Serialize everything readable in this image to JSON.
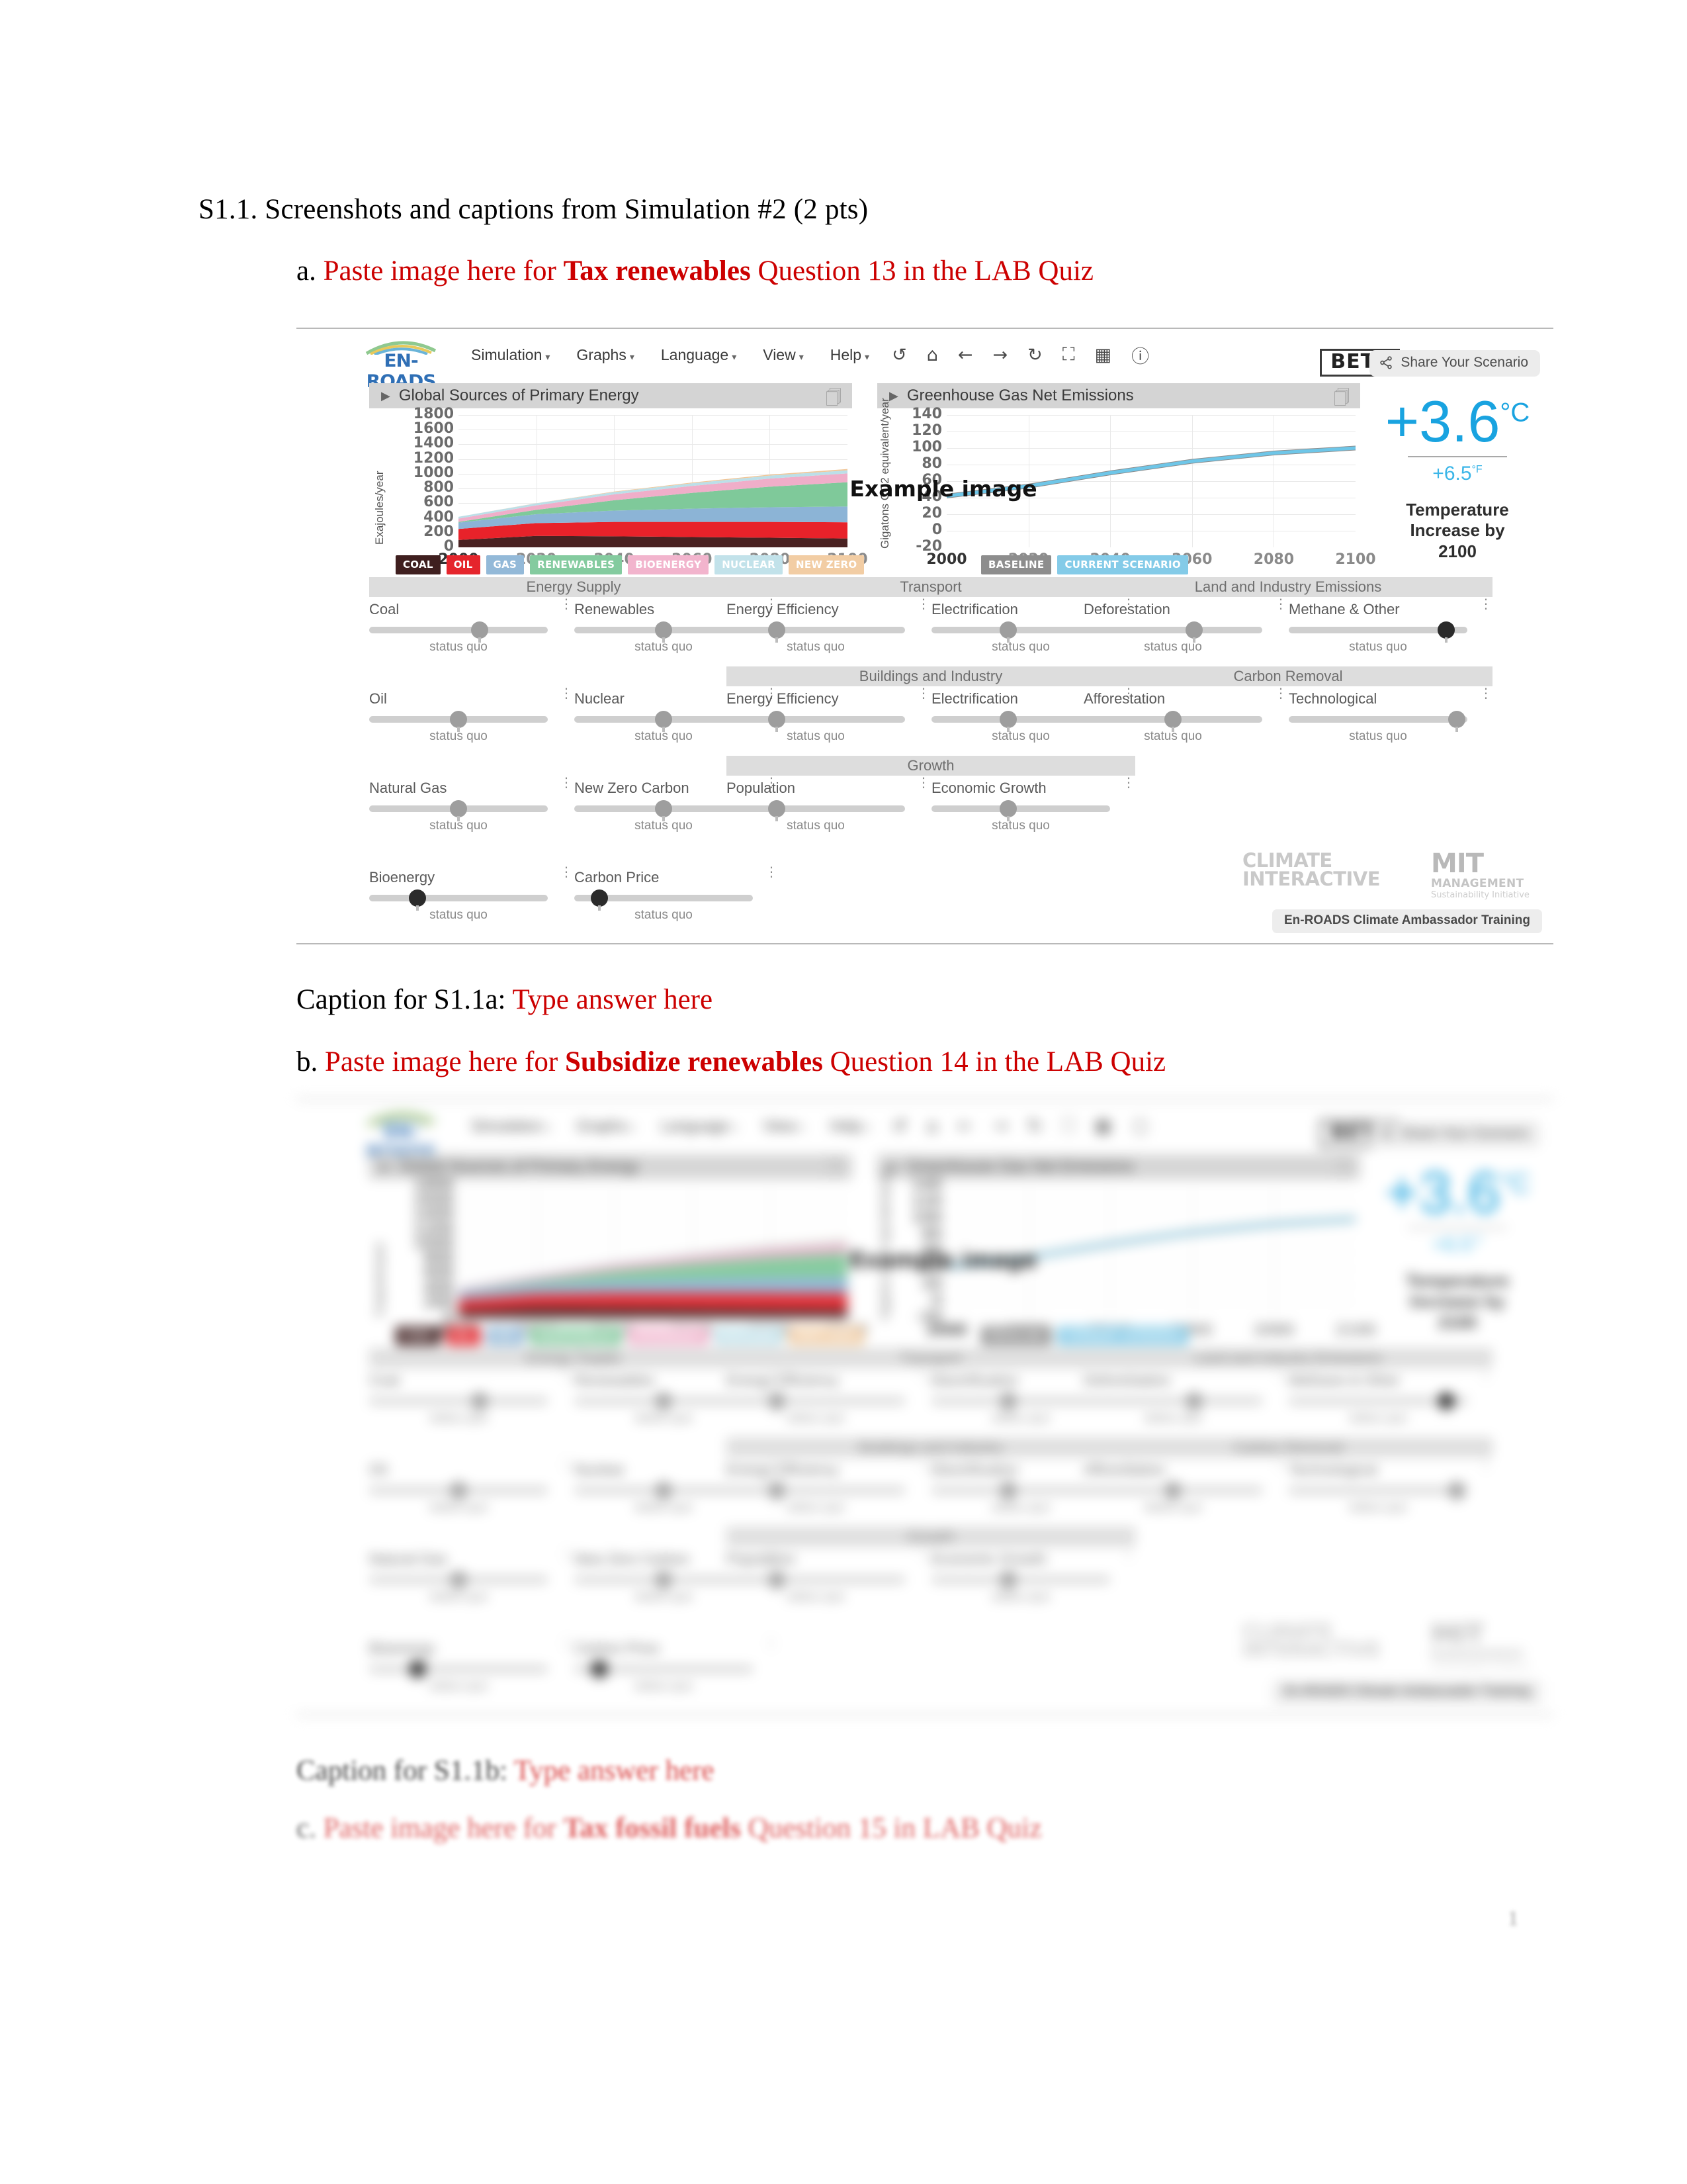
{
  "document": {
    "heading": "S1.1. Screenshots and captions from Simulation #2 (2 pts)",
    "page_number": "1",
    "items": [
      {
        "marker": "a.",
        "prefix": "Paste image here for ",
        "bold": "Tax renewables",
        "suffix": " Question 13 in the LAB Quiz"
      },
      {
        "marker": "b.",
        "prefix": "Paste image here for ",
        "bold": "Subsidize renewables",
        "suffix": " Question 14 in the LAB Quiz"
      },
      {
        "marker": "c.",
        "prefix": "Paste image here for ",
        "bold": "Tax fossil fuels",
        "suffix": " Question 15 in LAB Quiz"
      }
    ],
    "captions": [
      {
        "label": "Caption for S1.1a:",
        "answer": " Type answer here"
      },
      {
        "label": "Caption for S1.1b:",
        "answer": " Type answer here"
      }
    ]
  },
  "enroads": {
    "brand": "EN-ROADS",
    "menu": [
      {
        "label": "Simulation",
        "caret": "▾"
      },
      {
        "label": "Graphs",
        "caret": "▾"
      },
      {
        "label": "Language",
        "caret": "▾"
      },
      {
        "label": "View",
        "caret": "▾"
      },
      {
        "label": "Help",
        "caret": "▾"
      }
    ],
    "tool_icons": [
      {
        "name": "undo-icon",
        "glyph": "↺"
      },
      {
        "name": "home-icon",
        "glyph": "⌂"
      },
      {
        "name": "back-arrow-icon",
        "glyph": "←"
      },
      {
        "name": "forward-arrow-icon",
        "glyph": "→"
      },
      {
        "name": "redo-icon",
        "glyph": "↻"
      },
      {
        "name": "fullscreen-icon",
        "glyph": "⛶"
      },
      {
        "name": "grid-icon",
        "glyph": "▦"
      },
      {
        "name": "info-icon",
        "glyph": "ⓘ"
      }
    ],
    "beta_badge": "BETA",
    "share_button": "Share Your Scenario",
    "watermark": "Example image",
    "temperature": {
      "celsius": "+3.6",
      "celsius_unit": "°C",
      "fahrenheit": "+6.5",
      "fahrenheit_unit": "°F",
      "caption_line1": "Temperature",
      "caption_line2": "Increase by",
      "caption_line3": "2100"
    },
    "footer": {
      "climate_interactive_line1": "CLIMATE",
      "climate_interactive_line2": "INTERACTIVE",
      "mit": "MIT",
      "mit_management": "MANAGEMENT",
      "mit_sub": "Sustainability Initiative",
      "ambassador_button": "En-ROADS Climate Ambassador Training"
    },
    "slider_groups": [
      {
        "header": "Energy Supply",
        "rows": [
          [
            {
              "label": "Coal",
              "value": "status quo",
              "knob": 0.62,
              "dark": false
            },
            {
              "label": "Renewables",
              "value": "status quo",
              "knob": 0.5,
              "dark": false
            }
          ],
          [
            {
              "label": "Oil",
              "value": "status quo",
              "knob": 0.5,
              "dark": false
            },
            {
              "label": "Nuclear",
              "value": "status quo",
              "knob": 0.5,
              "dark": false
            }
          ],
          [
            {
              "label": "Natural Gas",
              "value": "status quo",
              "knob": 0.5,
              "dark": false
            },
            {
              "label": "New Zero Carbon",
              "value": "status quo",
              "knob": 0.5,
              "dark": false
            }
          ],
          [
            {
              "label": "Bioenergy",
              "value": "status quo",
              "knob": 0.27,
              "dark": true
            },
            {
              "label": "Carbon Price",
              "value": "status quo",
              "knob": 0.14,
              "dark": true
            }
          ]
        ]
      },
      {
        "header": "Transport",
        "rows": [
          [
            {
              "label": "Energy Efficiency",
              "value": "status quo",
              "knob": 0.28,
              "dark": false
            },
            {
              "label": "Electrification",
              "value": "status quo",
              "knob": 0.43,
              "dark": false
            }
          ]
        ]
      },
      {
        "header": "Buildings and Industry",
        "rows": [
          [
            {
              "label": "Energy Efficiency",
              "value": "status quo",
              "knob": 0.28,
              "dark": false
            },
            {
              "label": "Electrification",
              "value": "status quo",
              "knob": 0.43,
              "dark": false
            }
          ]
        ]
      },
      {
        "header": "Growth",
        "rows": [
          [
            {
              "label": "Population",
              "value": "status quo",
              "knob": 0.28,
              "dark": false
            },
            {
              "label": "Economic Growth",
              "value": "status quo",
              "knob": 0.43,
              "dark": false
            }
          ]
        ]
      },
      {
        "header": "Land and Industry Emissions",
        "rows": [
          [
            {
              "label": "Deforestation",
              "value": "status quo",
              "knob": 0.62,
              "dark": false
            },
            {
              "label": "Methane & Other",
              "value": "status quo",
              "knob": 0.88,
              "dark": true
            }
          ]
        ]
      },
      {
        "header": "Carbon Removal",
        "rows": [
          [
            {
              "label": "Afforestation",
              "value": "status quo",
              "knob": 0.5,
              "dark": false
            },
            {
              "label": "Technological",
              "value": "status quo",
              "knob": 0.94,
              "dark": false
            }
          ]
        ]
      }
    ]
  },
  "chart_data": [
    {
      "type": "area",
      "title": "Global Sources of Primary Energy",
      "xlabel": "",
      "ylabel": "Exajoules/year",
      "xlim": [
        2000,
        2100
      ],
      "ylim": [
        0,
        1800
      ],
      "xticks": [
        "2000",
        "2020",
        "2040",
        "2060",
        "2080",
        "2100"
      ],
      "yticks": [
        "0",
        "200",
        "400",
        "600",
        "800",
        "1000",
        "1200",
        "1400",
        "1600",
        "1800"
      ],
      "grid": true,
      "legend_position": "below",
      "x": [
        2000,
        2020,
        2040,
        2060,
        2080,
        2100
      ],
      "series": [
        {
          "name": "Coal",
          "color": "#4a2222",
          "values": [
            100,
            155,
            150,
            140,
            130,
            120
          ]
        },
        {
          "name": "Oil",
          "color": "#e8222a",
          "values": [
            150,
            175,
            195,
            205,
            215,
            220
          ]
        },
        {
          "name": "Gas",
          "color": "#8cb4d6",
          "values": [
            85,
            120,
            155,
            180,
            200,
            215
          ]
        },
        {
          "name": "Renewables",
          "color": "#7fc99a",
          "values": [
            10,
            60,
            140,
            215,
            280,
            330
          ]
        },
        {
          "name": "Bioenergy",
          "color": "#f0aec9",
          "values": [
            45,
            60,
            80,
            95,
            110,
            120
          ]
        },
        {
          "name": "Nuclear",
          "color": "#bcdfe8",
          "values": [
            25,
            28,
            32,
            36,
            40,
            42
          ]
        },
        {
          "name": "New Zero",
          "color": "#f0c79a",
          "values": [
            0,
            2,
            6,
            10,
            14,
            18
          ]
        }
      ],
      "legend": [
        "COAL",
        "OIL",
        "GAS",
        "RENEWABLES",
        "BIOENERGY",
        "NUCLEAR",
        "NEW ZERO"
      ],
      "legend_colors": [
        "#3f1f1f",
        "#e5252c",
        "#93b9d8",
        "#84cb9f",
        "#f2b4cd",
        "#c2e2ea",
        "#f2cda4"
      ]
    },
    {
      "type": "line",
      "title": "Greenhouse Gas Net Emissions",
      "xlabel": "",
      "ylabel": "Gigatons CO2 equivalent/year",
      "xlim": [
        2000,
        2100
      ],
      "ylim": [
        -20,
        140
      ],
      "xticks": [
        "2000",
        "2020",
        "2040",
        "2060",
        "2080",
        "2100"
      ],
      "yticks": [
        "-20",
        "0",
        "20",
        "40",
        "60",
        "80",
        "100",
        "120",
        "140"
      ],
      "grid": true,
      "legend_position": "below",
      "x": [
        2000,
        2020,
        2040,
        2060,
        2080,
        2100
      ],
      "series": [
        {
          "name": "Baseline",
          "color": "#8c8c8c",
          "values": [
            42,
            54,
            70,
            84,
            94,
            100
          ]
        },
        {
          "name": "Current Scenario",
          "color": "#6ec6e8",
          "values": [
            42,
            54,
            70,
            84,
            94,
            100
          ]
        }
      ],
      "legend": [
        "BASELINE",
        "CURRENT SCENARIO"
      ],
      "legend_colors": [
        "#8d8d8d",
        "#84cbe8"
      ]
    }
  ]
}
